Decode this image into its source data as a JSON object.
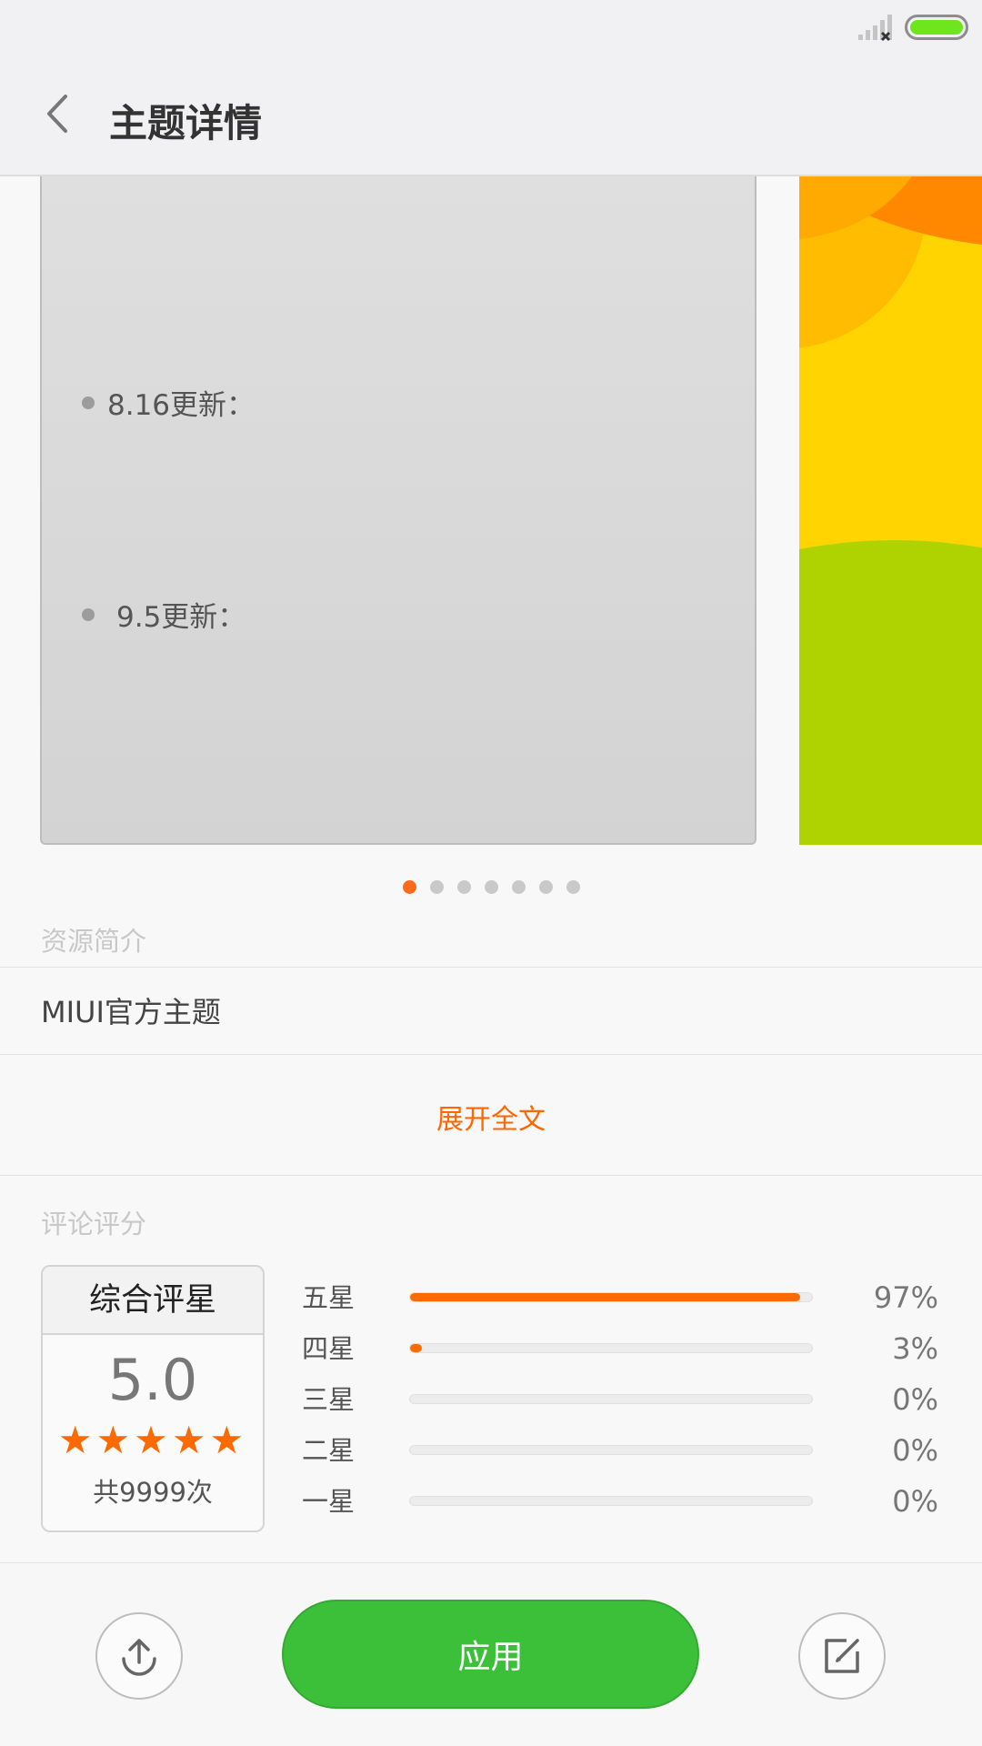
{
  "header": {
    "title": "主题详情"
  },
  "preview": {
    "bullets": [
      "8.16更新：",
      "9.5更新："
    ],
    "pager": {
      "total": 7,
      "active": 0
    }
  },
  "description": {
    "section_label": "资源简介",
    "text": "MIUI官方主题",
    "expand_label": "展开全文"
  },
  "ratings": {
    "section_label": "评论评分",
    "overall_label": "综合评星",
    "score": "5.0",
    "stars": "★★★★★",
    "count_text": "共9999次",
    "rows": [
      {
        "label": "五星",
        "percent": 97,
        "percent_text": "97%"
      },
      {
        "label": "四星",
        "percent": 3,
        "percent_text": "3%"
      },
      {
        "label": "三星",
        "percent": 0,
        "percent_text": "0%"
      },
      {
        "label": "二星",
        "percent": 0,
        "percent_text": "0%"
      },
      {
        "label": "一星",
        "percent": 0,
        "percent_text": "0%"
      }
    ]
  },
  "bottom_bar": {
    "share_icon": "share-upload-icon",
    "apply_label": "应用",
    "edit_icon": "edit-comment-icon"
  },
  "colors": {
    "accent": "#ff6a00",
    "apply_green": "#3cc03a",
    "battery_green": "#6ee51c"
  }
}
